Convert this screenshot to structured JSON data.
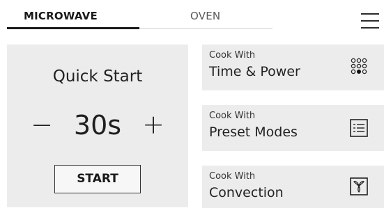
{
  "tabs": [
    {
      "label": "MICROWAVE",
      "active": true
    },
    {
      "label": "OVEN",
      "active": false
    }
  ],
  "menu": {
    "icon": "hamburger-menu-icon"
  },
  "quick_start": {
    "title": "Quick Start",
    "decrement_symbol": "−",
    "increment_symbol": "+",
    "time_value": "30s",
    "start_label": "START"
  },
  "cook_options": [
    {
      "subtitle": "Cook With",
      "title": "Time & Power",
      "icon": "dot-grid-icon"
    },
    {
      "subtitle": "Cook With",
      "title": "Preset Modes",
      "icon": "list-menu-icon"
    },
    {
      "subtitle": "Cook With",
      "title": "Convection",
      "icon": "fan-icon"
    }
  ],
  "colors": {
    "panel_bg": "#ececec",
    "text": "#1e1e1e",
    "active_tab_underline": "#1a1a1a"
  }
}
